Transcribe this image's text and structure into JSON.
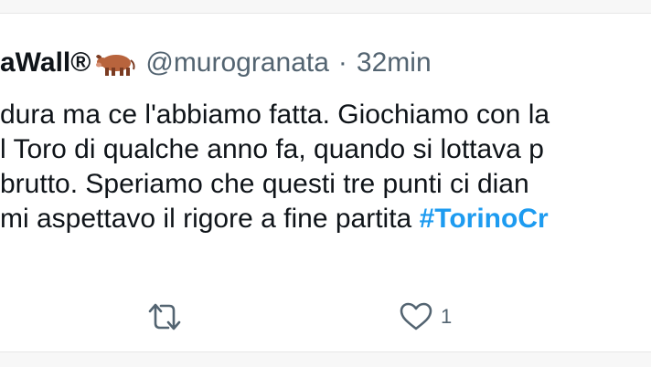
{
  "tweet": {
    "author_name": "aWall®",
    "handle": "@murogranata",
    "separator": "·",
    "time": "32min",
    "lines": [
      "dura ma ce l'abbiamo fatta. Giochiamo con la",
      "l Toro di qualche anno fa, quando si lottava p",
      "brutto. Speriamo che questi tre punti ci dian",
      "mi aspettavo il rigore a fine partita "
    ],
    "hashtag": "#TorinoCr",
    "like_count": "1"
  },
  "icons": {
    "author_emoji": "cow-emoji-icon",
    "retweet": "retweet-icon",
    "like": "heart-icon"
  },
  "colors": {
    "text": "#0f1419",
    "secondary": "#536471",
    "hashtag": "#1d9bf0"
  }
}
